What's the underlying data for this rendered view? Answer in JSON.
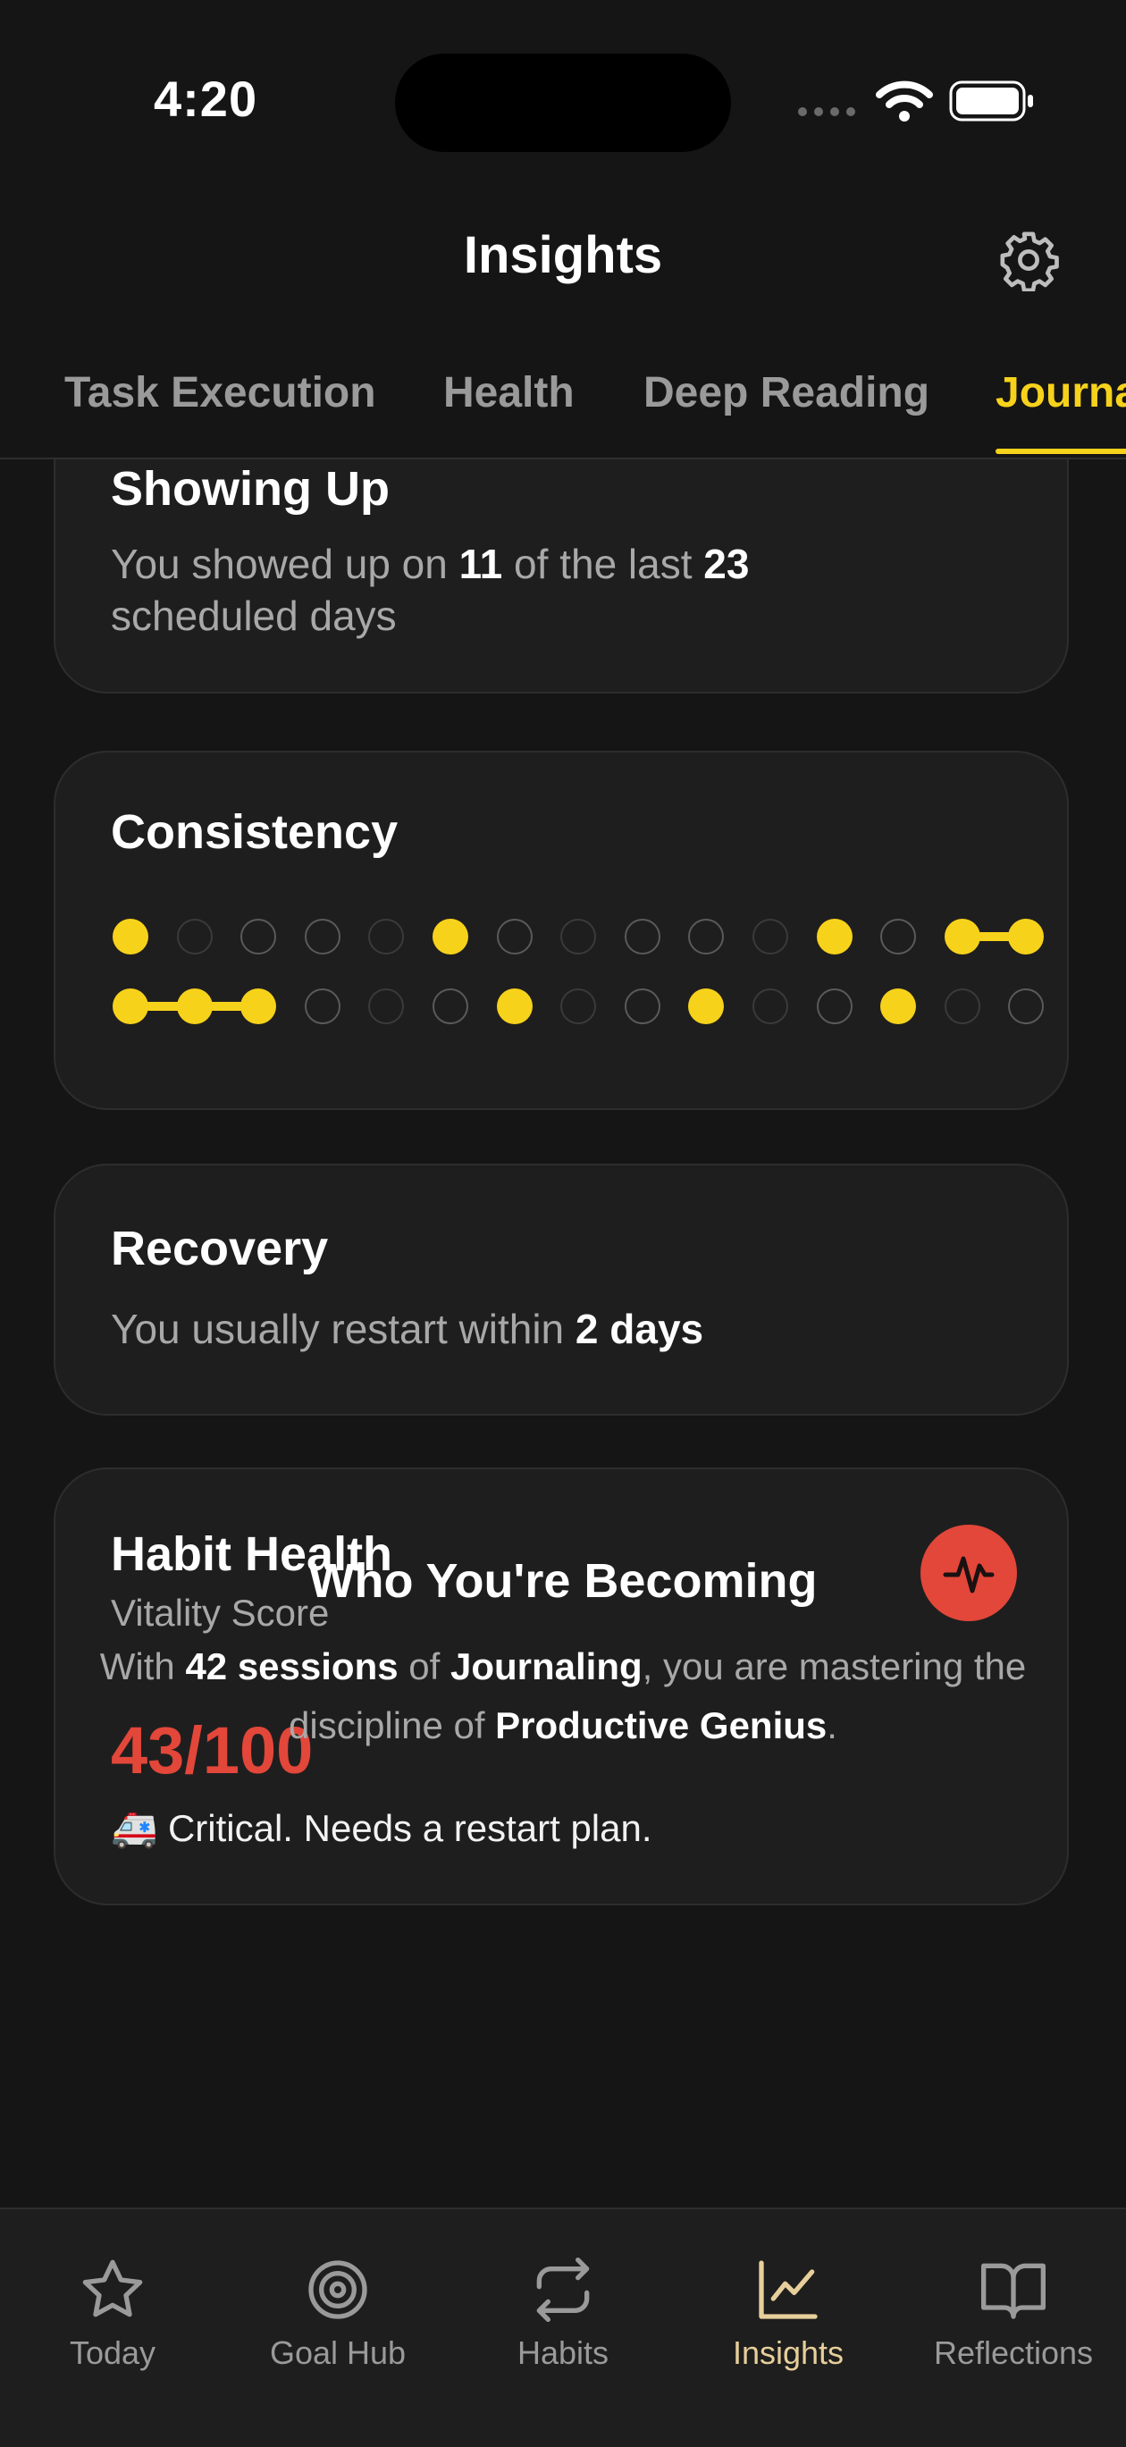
{
  "status_bar": {
    "time": "4:20"
  },
  "header": {
    "title": "Insights"
  },
  "tabs": [
    {
      "label": "Task Execution",
      "active": false
    },
    {
      "label": "Health",
      "active": false
    },
    {
      "label": "Deep Reading",
      "active": false
    },
    {
      "label": "Journaling",
      "active": true
    }
  ],
  "showing_up": {
    "title": "Showing Up",
    "prefix": "You showed up on ",
    "shown": "11",
    "mid": " of the last ",
    "total": "23",
    "suffix_line2": "scheduled days"
  },
  "consistency": {
    "title": "Consistency",
    "rows": [
      [
        1,
        0,
        0,
        0,
        0,
        1,
        0,
        0,
        0,
        0,
        0,
        1,
        0,
        1,
        1
      ],
      [
        1,
        1,
        1,
        0,
        0,
        0,
        1,
        0,
        0,
        1,
        0,
        0,
        1,
        0,
        0
      ]
    ]
  },
  "recovery": {
    "title": "Recovery",
    "prefix": "You usually restart within ",
    "value": "2 days"
  },
  "habit_health": {
    "title": "Habit Health",
    "subtitle": "Vitality Score",
    "score": "43/100",
    "emoji": "🚑",
    "status": "Critical. Needs a restart plan.",
    "accent": "#e2473a"
  },
  "becoming": {
    "title": "Who You're Becoming",
    "p1": "With ",
    "sessions": "42 sessions",
    "p2": " of ",
    "habit": "Journaling",
    "p3": ", you are mastering the discipline of ",
    "trait": "Productive Genius",
    "p4": "."
  },
  "nav": [
    {
      "label": "Today",
      "icon": "star-icon",
      "active": false
    },
    {
      "label": "Goal Hub",
      "icon": "target-icon",
      "active": false
    },
    {
      "label": "Habits",
      "icon": "repeat-icon",
      "active": false
    },
    {
      "label": "Insights",
      "icon": "chart-icon",
      "active": true
    },
    {
      "label": "Reflections",
      "icon": "book-icon",
      "active": false
    }
  ],
  "colors": {
    "accent": "#f7d21b",
    "danger": "#e2473a",
    "background": "#161515",
    "card": "#1f1e1e"
  }
}
